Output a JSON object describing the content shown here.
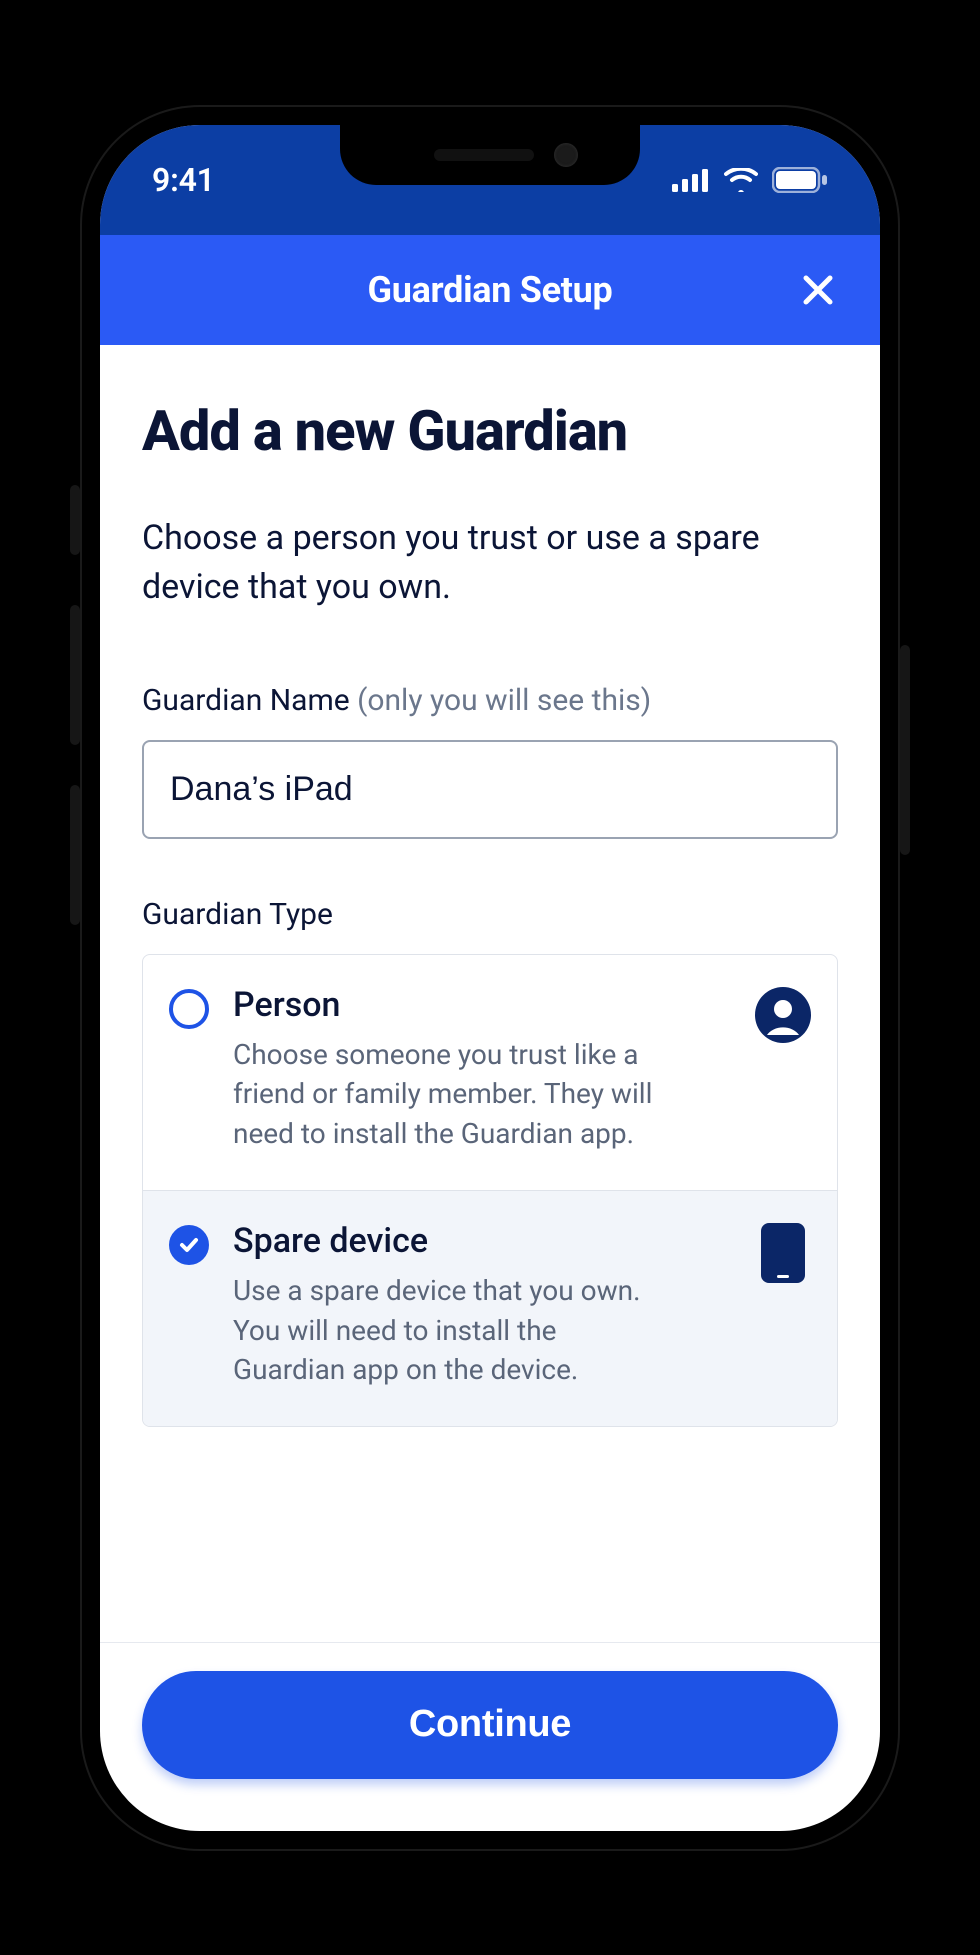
{
  "status": {
    "time": "9:41"
  },
  "header": {
    "title": "Guardian Setup"
  },
  "page": {
    "heading": "Add a new Guardian",
    "subtitle": "Choose a person you trust or use a spare device that you own."
  },
  "name_field": {
    "label": "Guardian Name ",
    "hint": "(only you will see this)",
    "value": "Dana’s iPad"
  },
  "type_section": {
    "label": "Guardian Type",
    "options": [
      {
        "title": "Person",
        "desc": "Choose someone you trust like a friend or family member. They will need to install the Guardian app.",
        "selected": false,
        "icon": "person"
      },
      {
        "title": "Spare device",
        "desc": "Use a spare device that you own. You will need to install the Guardian app on the device.",
        "selected": true,
        "icon": "device"
      }
    ]
  },
  "footer": {
    "cta": "Continue"
  }
}
